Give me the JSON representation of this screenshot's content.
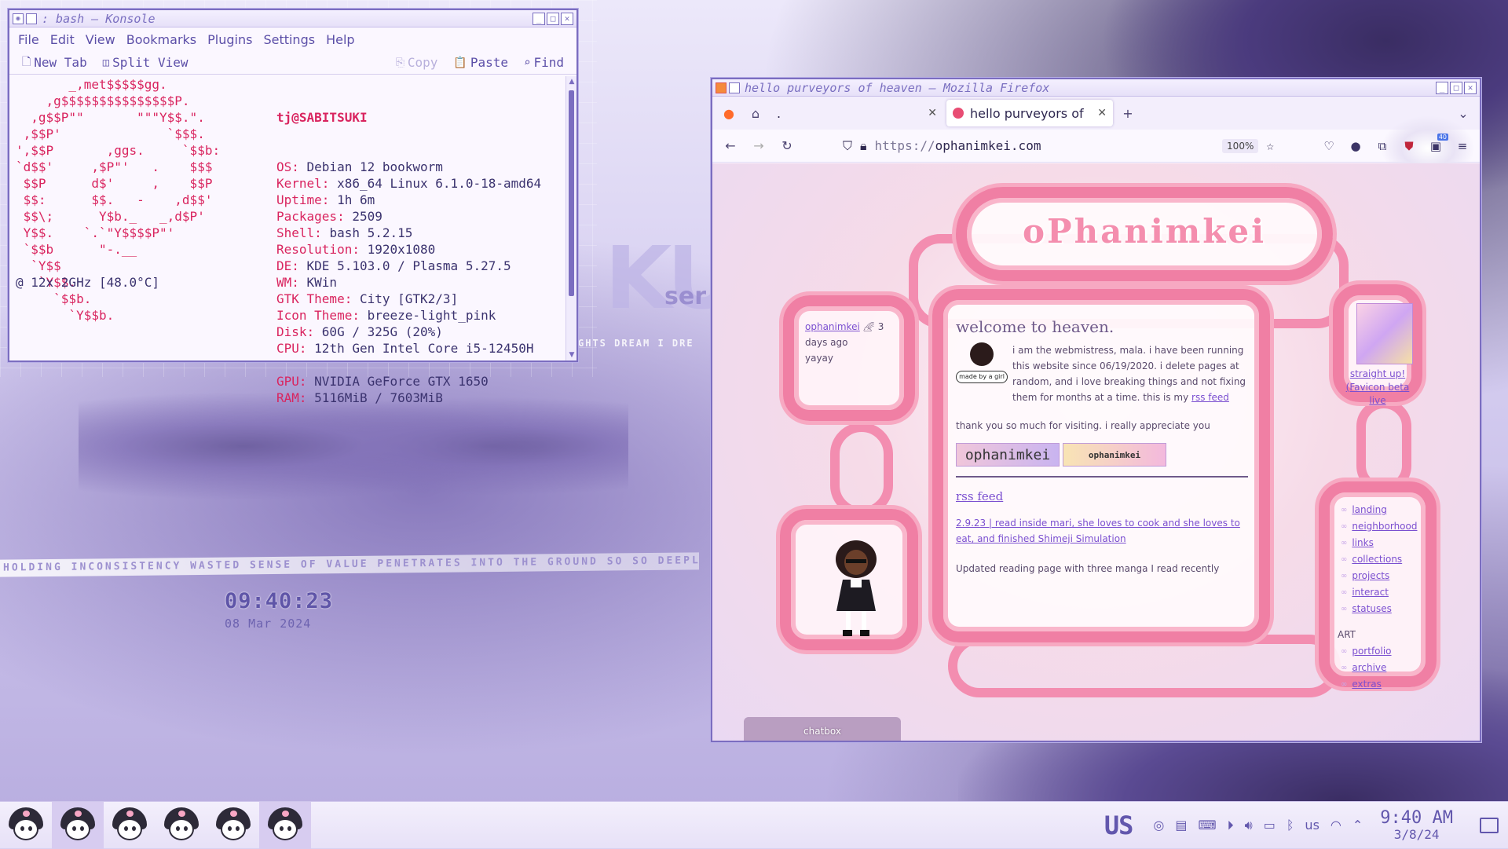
{
  "desktop": {
    "wallpaper_strip": "HOLDING INCONSISTENCY WASTED SENSE OF VALUE PENETRATES INTO THE GROUND SO SO DEEPLY",
    "wallpaper_strip2": "GHTS DREAM I DRE",
    "wallpaper_big": "KU",
    "wallpaper_small": "ser",
    "clock_time": "09:40:23",
    "clock_date": "08 Mar 2024"
  },
  "konsole": {
    "title": ": bash — Konsole",
    "menu": [
      "File",
      "Edit",
      "View",
      "Bookmarks",
      "Plugins",
      "Settings",
      "Help"
    ],
    "toolbar": {
      "new_tab": "New Tab",
      "split_view": "Split View",
      "copy": "Copy",
      "paste": "Paste",
      "find": "Find"
    },
    "logo_lines": "       _,met$$$$$gg.\n    ,g$$$$$$$$$$$$$$$P.\n  ,g$$P\"\"       \"\"\"Y$$.\".\n ,$$P'              `$$$.\n',$$P       ,ggs.     `$$b:\n`d$$'     ,$P\"'   .    $$$\n $$P      d$'     ,    $$P\n $$:      $$.   -    ,d$$'\n $$\\;      Y$b._   _,d$P'\n Y$$.    `.`\"Y$$$$P\"'\n `$$b      \"-.__\n  `Y$$\n   `Y$$.",
    "logo_tail": "     `$$b.\n       `Y$$b.",
    "cpu_wrap": "@ 12x 2GHz [48.0°C]",
    "user": "tj@SABITSUKI",
    "info": [
      {
        "k": "OS",
        "v": "Debian 12 bookworm"
      },
      {
        "k": "Kernel",
        "v": "x86_64 Linux 6.1.0-18-amd64"
      },
      {
        "k": "Uptime",
        "v": "1h 6m"
      },
      {
        "k": "Packages",
        "v": "2509"
      },
      {
        "k": "Shell",
        "v": "bash 5.2.15"
      },
      {
        "k": "Resolution",
        "v": "1920x1080"
      },
      {
        "k": "DE",
        "v": "KDE 5.103.0 / Plasma 5.27.5"
      },
      {
        "k": "WM",
        "v": "KWin"
      },
      {
        "k": "GTK Theme",
        "v": "City [GTK2/3]"
      },
      {
        "k": "Icon Theme",
        "v": "breeze-light_pink"
      },
      {
        "k": "Disk",
        "v": "60G / 325G (20%)"
      },
      {
        "k": "CPU",
        "v": "12th Gen Intel Core i5-12450H"
      },
      {
        "k": "GPU",
        "v": "NVIDIA GeForce GTX 1650"
      },
      {
        "k": "RAM",
        "v": "5116MiB / 7603MiB"
      }
    ]
  },
  "firefox": {
    "title": "hello purveyors of heaven — Mozilla Firefox",
    "tabs": [
      {
        "label": ".",
        "active": false
      },
      {
        "label": "hello purveyors of",
        "active": true
      }
    ],
    "url_proto": "https://",
    "url_host": "ophanimkei.com",
    "zoom": "100%",
    "ext_badge": "40",
    "page": {
      "site_title": "oPhanimkei",
      "status_name": "ophanimkei",
      "status_time": "3 days ago",
      "status_msg": "yayay",
      "welcome": "welcome to heaven.",
      "madeby": "made by a girl",
      "intro": "i am the webmistress, mala. i have been running this website since 06/19/2020. i delete pages at random, and i love breaking things and not fixing them for months at a time. this is my",
      "intro_link": "rss feed",
      "thanks": "thank you so much for visiting. i really appreciate you",
      "button1": "ophanimkei",
      "button2": "ophanimkei",
      "rss_heading": "rss feed",
      "rss_item": "2.9.23 | read inside mari, she loves to cook and she loves to eat, and finished Shimeji Simulation",
      "rss_item2": "Updated reading page with three manga I read recently",
      "stamp_text": "straight up! (Favicon beta live",
      "nav": [
        "landing",
        "neighborhood",
        "links",
        "collections",
        "projects",
        "interact",
        "statuses"
      ],
      "art_heading": "ART",
      "art_nav": [
        "portfolio",
        "archive",
        "extras"
      ],
      "chatbox": "chatbox"
    }
  },
  "taskbar": {
    "tasks": [
      "kuromi-1",
      "kuromi-2",
      "kuromi-3",
      "kuromi-4",
      "kuromi-5",
      "kuromi-6"
    ],
    "active_tasks": [
      1,
      5
    ],
    "keyboard_layout": "US",
    "lang": "us",
    "time": "9:40 AM",
    "date": "3/8/24"
  }
}
